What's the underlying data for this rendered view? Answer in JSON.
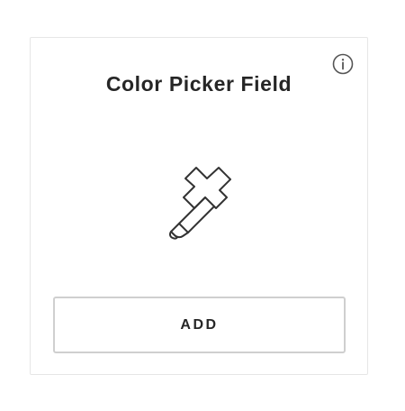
{
  "card": {
    "title": "Color Picker Field",
    "info_icon": "info-circle-icon",
    "picker_icon": "eyedropper-icon",
    "add_label": "ADD"
  },
  "colors": {
    "title_text": "#262626",
    "icon_stroke": "#333333",
    "card_border": "#e6e6e6",
    "button_border": "#cfcfcf",
    "background": "#ffffff"
  }
}
